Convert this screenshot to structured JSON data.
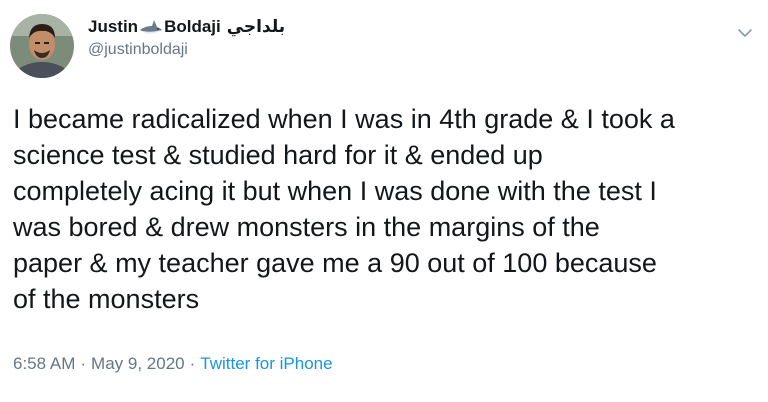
{
  "author": {
    "display_name_first": "Justin",
    "display_name_last": "Boldaji",
    "display_name_arabic": "بلداجي",
    "name_emoji_icon": "shark-icon",
    "handle": "@justinboldaji"
  },
  "tweet": {
    "lines": [
      "I became radicalized when I was in 4th grade & I took a",
      "science test & studied hard for it & ended up",
      "completely acing it but when I was done with the test I",
      "was bored & drew monsters in the margins of the",
      "paper & my teacher gave me a 90 out of 100 because",
      "of the monsters"
    ]
  },
  "meta": {
    "time": "6:58 AM",
    "separator": "·",
    "date": "May 9, 2020",
    "source": "Twitter for iPhone"
  },
  "colors": {
    "text": "#14171a",
    "secondary": "#657786",
    "link": "#1b95e0"
  }
}
